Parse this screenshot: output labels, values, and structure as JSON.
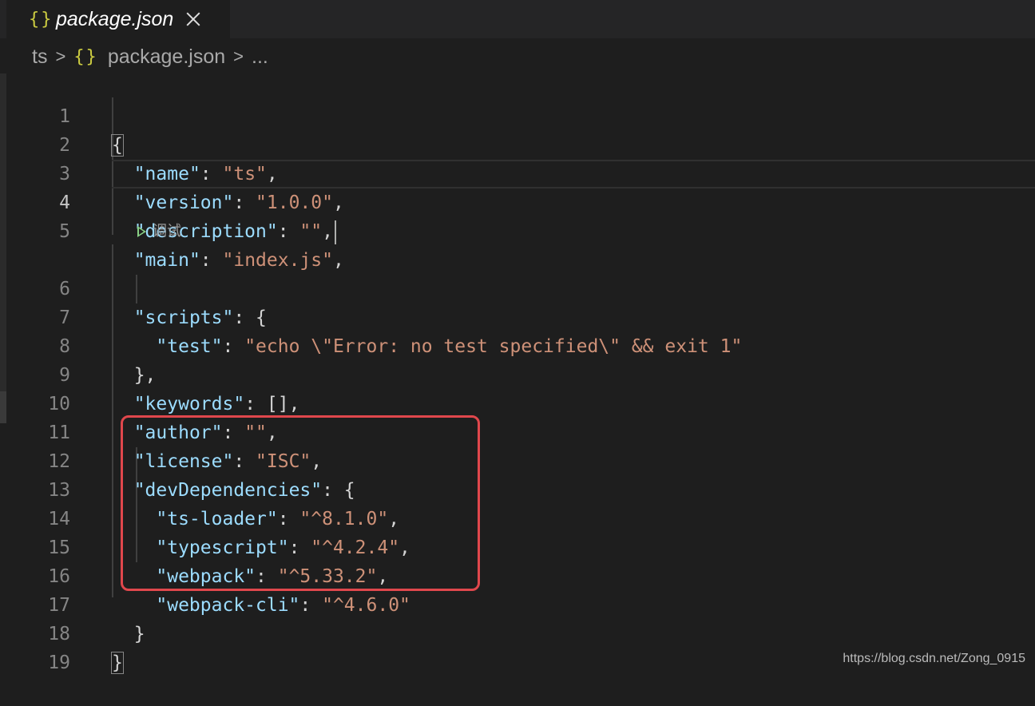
{
  "tab": {
    "icon": "json-icon",
    "title": "package.json",
    "close_icon": "close-icon"
  },
  "breadcrumb": {
    "folder": "ts",
    "file_icon": "json-icon",
    "file": "package.json",
    "more": "..."
  },
  "codelens": {
    "icon": "play-icon",
    "label": "调试"
  },
  "current_line": 4,
  "lines": [
    {
      "num": "1"
    },
    {
      "num": "2",
      "key": "\"name\"",
      "value": "\"ts\""
    },
    {
      "num": "3",
      "key": "\"version\"",
      "value": "\"1.0.0\""
    },
    {
      "num": "4",
      "key": "\"description\"",
      "value": "\"\""
    },
    {
      "num": "5",
      "key": "\"main\"",
      "value": "\"index.js\""
    },
    {
      "num": "6",
      "key": "\"scripts\""
    },
    {
      "num": "7",
      "key": "\"test\"",
      "value": "\"echo \\\"Error: no test specified\\\" && exit 1\""
    },
    {
      "num": "8"
    },
    {
      "num": "9",
      "key": "\"keywords\"",
      "value": "[]"
    },
    {
      "num": "10",
      "key": "\"author\"",
      "value": "\"\""
    },
    {
      "num": "11",
      "key": "\"license\"",
      "value": "\"ISC\""
    },
    {
      "num": "12",
      "key": "\"devDependencies\""
    },
    {
      "num": "13",
      "key": "\"ts-loader\"",
      "value": "\"^8.1.0\""
    },
    {
      "num": "14",
      "key": "\"typescript\"",
      "value": "\"^4.2.4\""
    },
    {
      "num": "15",
      "key": "\"webpack\"",
      "value": "\"^5.33.2\""
    },
    {
      "num": "16",
      "key": "\"webpack-cli\"",
      "value": "\"^4.6.0\""
    },
    {
      "num": "17"
    },
    {
      "num": "18"
    },
    {
      "num": "19"
    }
  ],
  "watermark": "https://blog.csdn.net/Zong_0915",
  "colors": {
    "editor_bg": "#1e1e1e",
    "key": "#9cdcfe",
    "string": "#ce9178",
    "highlight_box": "#e0474c",
    "json_icon": "#cbcb41"
  }
}
